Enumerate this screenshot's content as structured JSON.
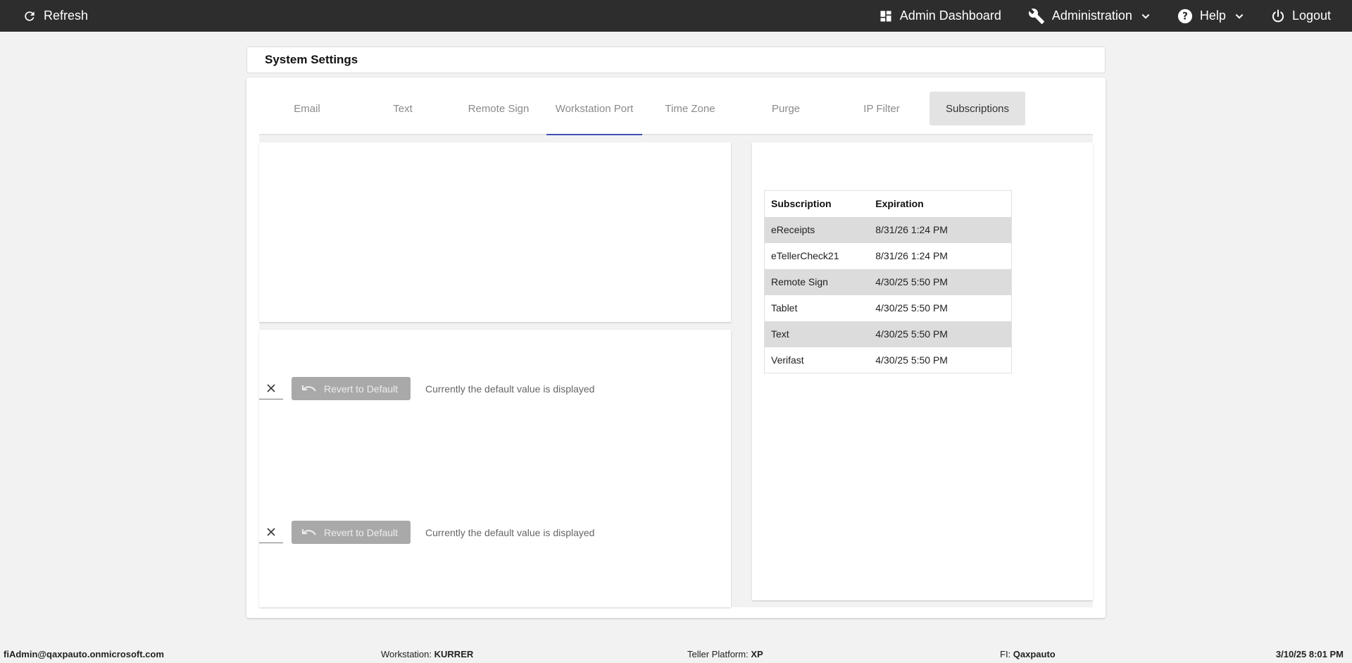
{
  "topbar": {
    "refresh_label": "Refresh",
    "admin_dashboard_label": "Admin Dashboard",
    "administration_label": "Administration",
    "help_label": "Help",
    "logout_label": "Logout"
  },
  "page": {
    "title": "System Settings"
  },
  "tabs": [
    {
      "label": "Email"
    },
    {
      "label": "Text"
    },
    {
      "label": "Remote Sign"
    },
    {
      "label": "Workstation Port"
    },
    {
      "label": "Time Zone"
    },
    {
      "label": "Purge"
    },
    {
      "label": "IP Filter"
    },
    {
      "label": "Subscriptions"
    }
  ],
  "settings": [
    {
      "revert_label": "Revert to Default",
      "note": "Currently the default value is displayed"
    },
    {
      "revert_label": "Revert to Default",
      "note": "Currently the default value is displayed"
    }
  ],
  "subscriptions": {
    "headers": [
      "Subscription",
      "Expiration"
    ],
    "rows": [
      {
        "name": "eReceipts",
        "expiration": "8/31/26 1:24 PM"
      },
      {
        "name": "eTellerCheck21",
        "expiration": "8/31/26 1:24 PM"
      },
      {
        "name": "Remote Sign",
        "expiration": "4/30/25 5:50 PM"
      },
      {
        "name": "Tablet",
        "expiration": "4/30/25 5:50 PM"
      },
      {
        "name": "Text",
        "expiration": "4/30/25 5:50 PM"
      },
      {
        "name": "Verifast",
        "expiration": "4/30/25 5:50 PM"
      }
    ]
  },
  "footer": {
    "user": "fiAdmin@qaxpauto.onmicrosoft.com",
    "workstation_label": "Workstation:",
    "workstation_value": "KURRER",
    "platform_label": "Teller Platform:",
    "platform_value": "XP",
    "fi_label": "FI:",
    "fi_value": "Qaxpauto",
    "datetime": "3/10/25 8:01 PM"
  },
  "colors": {
    "topbar_bg": "#2d2d2d",
    "active_tab_underline": "#3f51b5",
    "revert_button_bg": "#a9a9a9",
    "row_alt_bg": "#dcdcdc"
  },
  "icons": {
    "refresh": "refresh-icon",
    "dashboard": "dashboard-icon",
    "administration": "wrench-icon",
    "help": "help-circle-icon",
    "logout": "power-icon",
    "clear": "close-icon",
    "revert": "undo-icon"
  }
}
